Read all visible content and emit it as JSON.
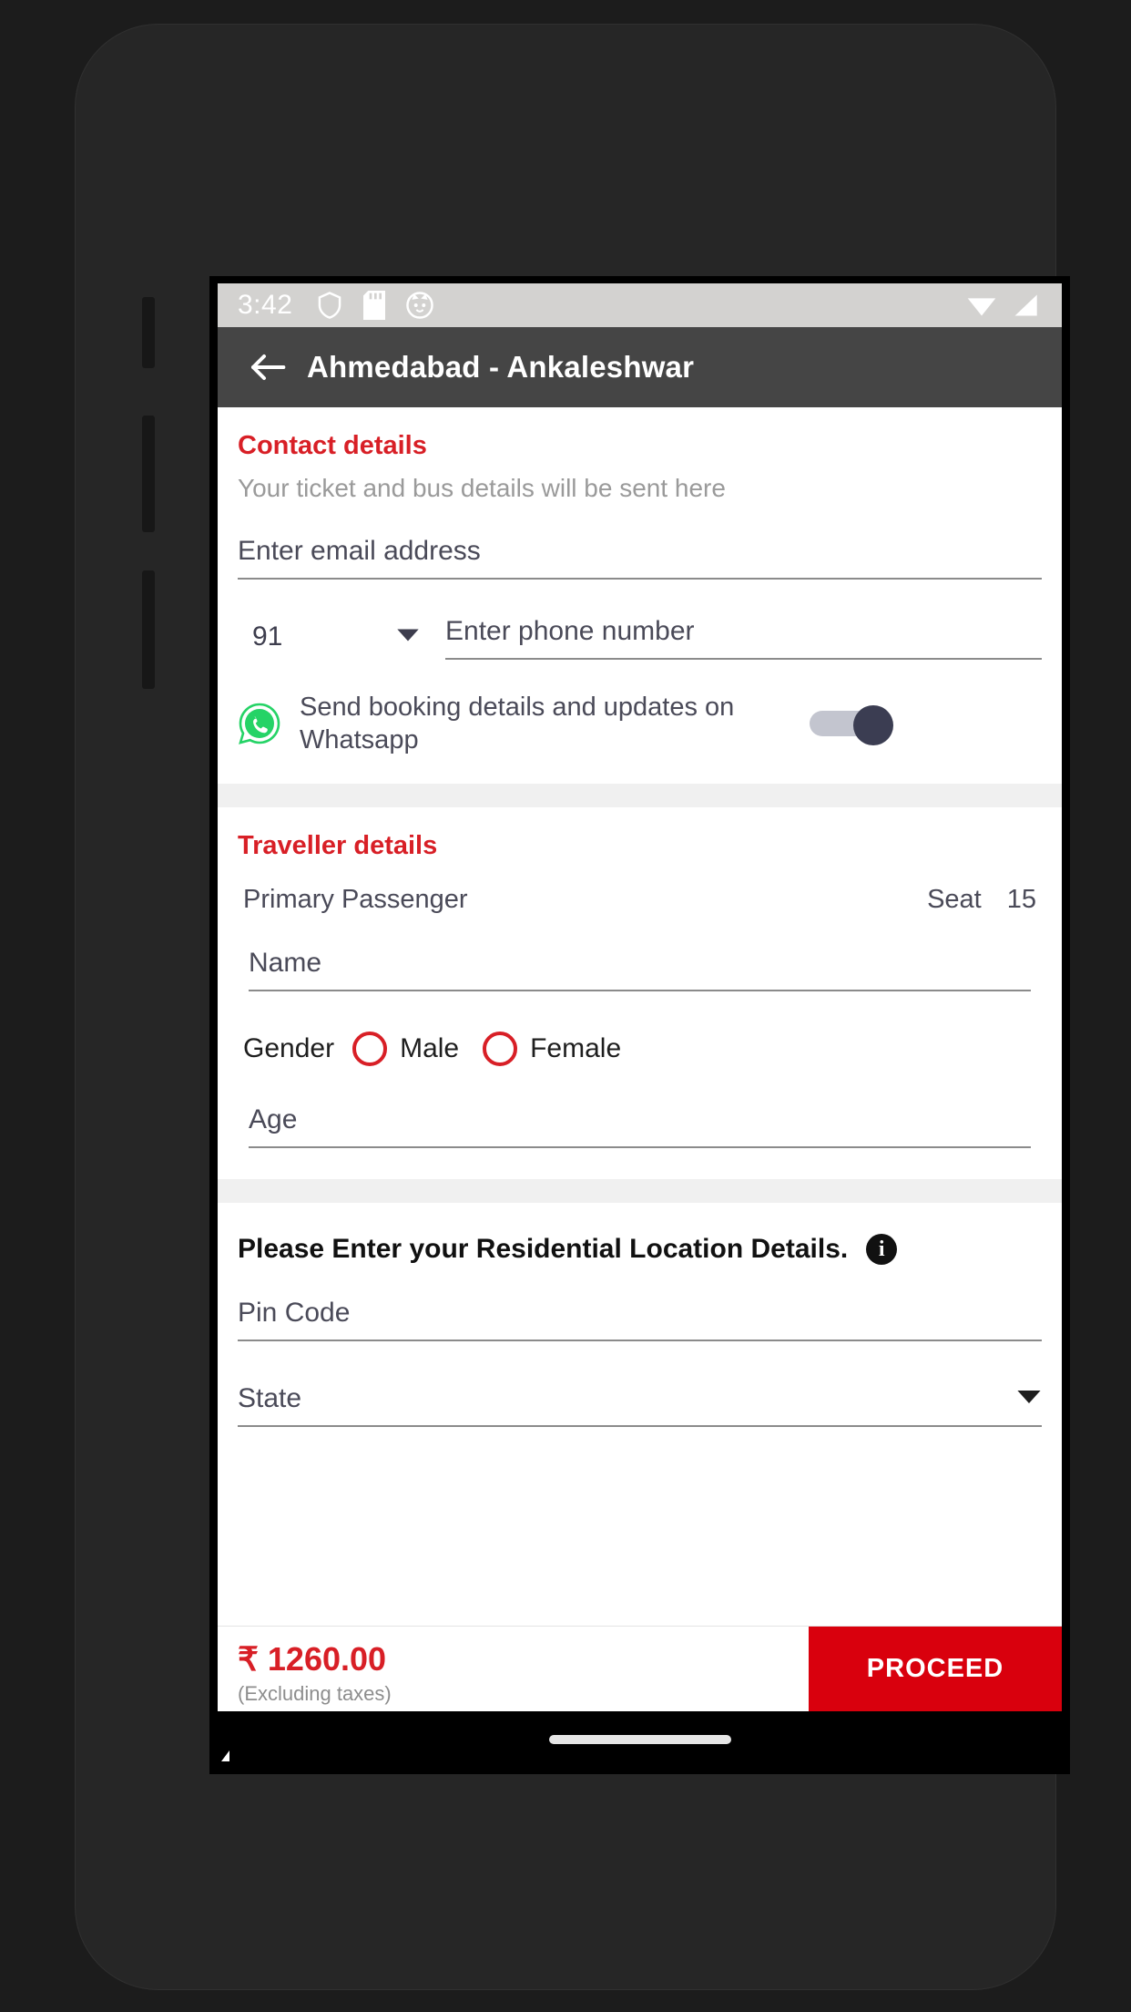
{
  "status_bar": {
    "time": "3:42",
    "icons": [
      "shield-icon",
      "sd-card-icon",
      "cat-face-icon"
    ],
    "right_icons": [
      "wifi-icon",
      "signal-icon"
    ]
  },
  "app_bar": {
    "back_icon": "back-arrow-icon",
    "title": "Ahmedabad - Ankaleshwar"
  },
  "contact": {
    "title": "Contact details",
    "subtitle": "Your ticket and bus details will be sent here",
    "email_placeholder": "Enter email address",
    "email_value": "",
    "country_code": "91",
    "country_dropdown_icon": "chevron-down-icon",
    "phone_placeholder": "Enter phone number",
    "phone_value": "",
    "whatsapp_icon": "whatsapp-icon",
    "whatsapp_label": "Send booking details and updates on Whatsapp",
    "whatsapp_toggle_state": "on"
  },
  "traveller": {
    "title": "Traveller details",
    "passenger_label": "Primary Passenger",
    "seat_label": "Seat",
    "seat_number": "15",
    "name_placeholder": "Name",
    "name_value": "",
    "gender_label": "Gender",
    "gender_options": [
      {
        "label": "Male",
        "selected": false
      },
      {
        "label": "Female",
        "selected": false
      }
    ],
    "age_placeholder": "Age",
    "age_value": ""
  },
  "residential": {
    "heading": "Please Enter your Residential Location Details.",
    "info_icon": "info-icon",
    "info_glyph": "i",
    "pincode_placeholder": "Pin Code",
    "pincode_value": "",
    "state_placeholder": "State",
    "state_value": "",
    "state_dropdown_icon": "chevron-down-icon"
  },
  "bottom_bar": {
    "price": "₹ 1260.00",
    "price_note": "(Excluding taxes)",
    "proceed_label": "PROCEED"
  },
  "colors": {
    "brand_red": "#d81f26",
    "proceed_red": "#d9000d",
    "app_bar": "#454545",
    "status_bar": "#d3d2d0",
    "text_dark": "#4a4a58",
    "whatsapp_green": "#25D366"
  }
}
